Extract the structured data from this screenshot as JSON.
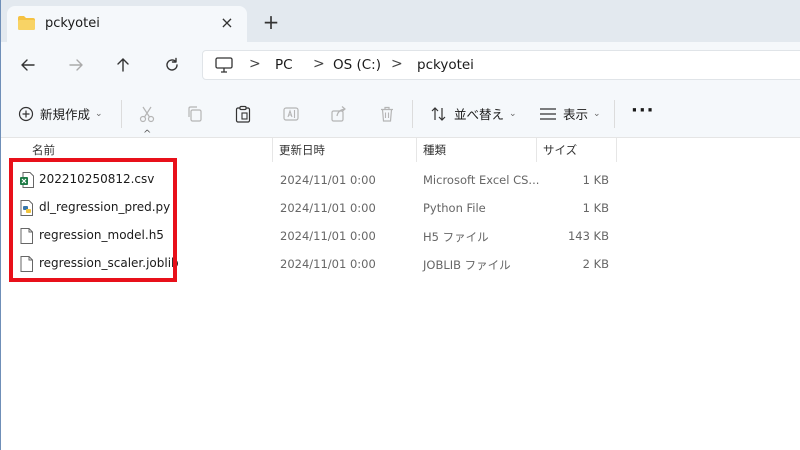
{
  "window": {
    "tab_title": "pckyotei",
    "close_glyph": "×",
    "new_tab_glyph": "+"
  },
  "address": {
    "breadcrumbs": [
      "PC",
      "OS (C:)",
      "pckyotei"
    ],
    "separator": ">"
  },
  "toolbar": {
    "new_label": "新規作成",
    "sort_label": "並べ替え",
    "view_label": "表示",
    "more_glyph": "···",
    "chevron": "⌄"
  },
  "columns": {
    "name": "名前",
    "date": "更新日時",
    "type": "種類",
    "size": "サイズ",
    "sort_caret": "^"
  },
  "files": [
    {
      "name": "202210250812.csv",
      "date": "2024/11/01 0:00",
      "type": "Microsoft Excel CS...",
      "size": "1 KB",
      "icon": "excel-csv-icon"
    },
    {
      "name": "dl_regression_pred.py",
      "date": "2024/11/01 0:00",
      "type": "Python File",
      "size": "1 KB",
      "icon": "python-file-icon"
    },
    {
      "name": "regression_model.h5",
      "date": "2024/11/01 0:00",
      "type": "H5 ファイル",
      "size": "143 KB",
      "icon": "file-icon"
    },
    {
      "name": "regression_scaler.joblib",
      "date": "2024/11/01 0:00",
      "type": "JOBLIB ファイル",
      "size": "2 KB",
      "icon": "file-icon"
    }
  ],
  "colors": {
    "highlight": "#e8101a",
    "tabstrip": "#e3e9ef",
    "chrome": "#f5f8fb",
    "folder": "#f5c242"
  }
}
